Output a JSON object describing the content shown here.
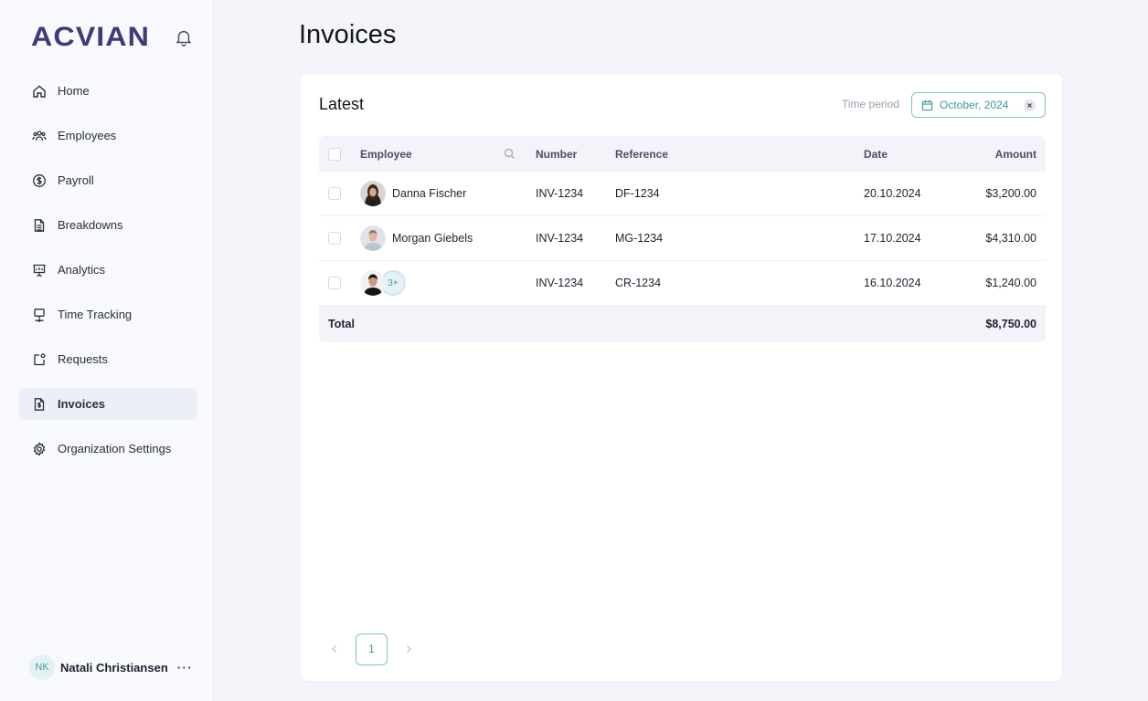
{
  "app": {
    "logo_text": "ACVIAN",
    "brand_color": "#3d3b7a",
    "accent_color": "#3b97a3"
  },
  "sidebar": {
    "items": [
      {
        "label": "Home",
        "icon": "home-icon"
      },
      {
        "label": "Employees",
        "icon": "users-icon"
      },
      {
        "label": "Payroll",
        "icon": "dollar-circle-icon"
      },
      {
        "label": "Breakdowns",
        "icon": "document-icon"
      },
      {
        "label": "Analytics",
        "icon": "presentation-chart-icon"
      },
      {
        "label": "Time Tracking",
        "icon": "monitor-icon"
      },
      {
        "label": "Requests",
        "icon": "request-icon"
      },
      {
        "label": "Invoices",
        "icon": "invoice-icon",
        "active": true
      },
      {
        "label": "Organization Settings",
        "icon": "gear-icon"
      }
    ],
    "user": {
      "initials": "NK",
      "name": "Natali Christiansen",
      "more": "···"
    }
  },
  "main": {
    "title": "Invoices",
    "card": {
      "title": "Latest",
      "period_label": "Time period",
      "period_value": "October, 2024"
    },
    "table": {
      "headers": {
        "employee": "Employee",
        "number": "Number",
        "reference": "Reference",
        "date": "Date",
        "amount": "Amount"
      },
      "rows": [
        {
          "employee": "Danna Fischer",
          "number": "INV-1234",
          "reference": "DF-1234",
          "date": "20.10.2024",
          "amount": "$3,200.00"
        },
        {
          "employee": "Morgan Giebels",
          "number": "INV-1234",
          "reference": "MG-1234",
          "date": "17.10.2024",
          "amount": "$4,310.00"
        },
        {
          "employee": "",
          "more_badge": "3+",
          "number": "INV-1234",
          "reference": "CR-1234",
          "date": "16.10.2024",
          "amount": "$1,240.00"
        }
      ],
      "total_label": "Total",
      "total_value": "$8,750.00"
    },
    "pagination": {
      "current_page": "1"
    }
  }
}
